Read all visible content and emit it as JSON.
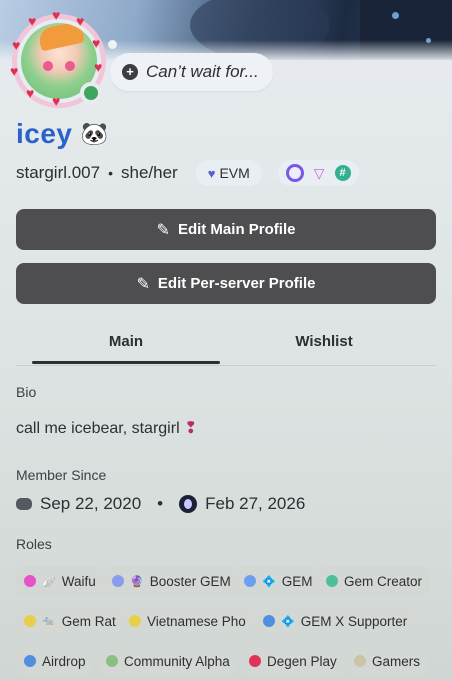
{
  "profile": {
    "custom_status": "Can’t wait for...",
    "display_name": "icey",
    "name_emoji": "🐼",
    "username": "stargirl.007",
    "separator": "•",
    "pronouns": "she/her",
    "tag_badge": "EVM"
  },
  "buttons": {
    "edit_main": "Edit Main Profile",
    "edit_server": "Edit Per-server Profile"
  },
  "tabs": [
    "Main",
    "Wishlist"
  ],
  "bio": {
    "label": "Bio",
    "text": "call me icebear, stargirl",
    "emoji": "❢"
  },
  "member_since": {
    "label": "Member Since",
    "discord_date": "Sep 22, 2020",
    "separator": "•",
    "server_date": "Feb 27, 2026"
  },
  "roles": {
    "label": "Roles",
    "items": [
      {
        "name": "Waifu",
        "color": "#e653c8",
        "emoji": "🪽"
      },
      {
        "name": "Booster GEM",
        "color": "#8a9cf0",
        "emoji": "🔮"
      },
      {
        "name": "GEM",
        "color": "#6b9ff0",
        "emoji": "💠"
      },
      {
        "name": "Gem Creator",
        "color": "#4fbf9a",
        "emoji": ""
      },
      {
        "name": "Gem Rat",
        "color": "#e8cf4a",
        "emoji": "🐀"
      },
      {
        "name": "Vietnamese Pho",
        "color": "#e8cf4a",
        "emoji": ""
      },
      {
        "name": "GEM X Supporter",
        "color": "#4f8fe0",
        "emoji": "💠"
      },
      {
        "name": "Airdrop",
        "color": "#4f8fe0",
        "emoji": ""
      },
      {
        "name": "Community Alpha",
        "color": "#8dbf84",
        "emoji": ""
      },
      {
        "name": "Degen Play",
        "color": "#e0335a",
        "emoji": ""
      },
      {
        "name": "Gamers",
        "color": "#cbc3a6",
        "emoji": ""
      }
    ]
  }
}
